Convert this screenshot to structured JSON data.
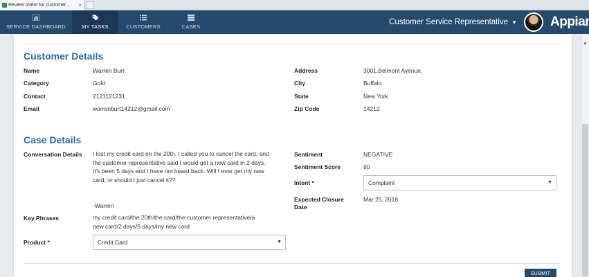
{
  "browser": {
    "tab_title": "Review Intent for customer ...",
    "tab_close": "×"
  },
  "header": {
    "nav": [
      {
        "label": "SERVICE DASHBOARD",
        "icon": "bar-chart-icon"
      },
      {
        "label": "MY TASKS",
        "icon": "tag-icon",
        "active": true
      },
      {
        "label": "CUSTOMERS",
        "icon": "list-icon"
      },
      {
        "label": "CASES",
        "icon": "stack-icon"
      }
    ],
    "role": "Customer Service Representative",
    "brand": "Appian",
    "colors": {
      "bar": "#264a6e",
      "active_tab": "#1c3856"
    }
  },
  "customer_details": {
    "title": "Customer Details",
    "left": [
      {
        "label": "Name",
        "value": "Warren Burt"
      },
      {
        "label": "Category",
        "value": "Gold"
      },
      {
        "label": "Contact",
        "value": "2121121231"
      },
      {
        "label": "Email",
        "value": "warrenburt14212@gmail.com"
      }
    ],
    "right": [
      {
        "label": "Address",
        "value": "3001,Belmont Avenue,"
      },
      {
        "label": "City",
        "value": "Buffalo"
      },
      {
        "label": "State",
        "value": "New York"
      },
      {
        "label": "Zip Code",
        "value": "14212"
      }
    ]
  },
  "case_details": {
    "title": "Case Details",
    "conversation_label": "Conversation Details",
    "conversation_lines": [
      "I lost my credit card on the 20th. I called you to cancel the card, and",
      "the customer representative said I would get a new card in 2 days.",
      "It's been 5 days and I have not heard back. Will I ever get my new",
      "card, or should I just cancel it??"
    ],
    "signature": "-Warren",
    "key_phrases_label": "Key Phrases",
    "key_phrases_lines": [
      "my credit card/the 20th/the card/the customer representative/a",
      "new card/2 days/5 days/my new card"
    ],
    "product_label": "Product *",
    "product_value": "Credit Card",
    "sentiment_label": "Sentiment",
    "sentiment_value": "NEGATIVE",
    "score_label": "Sentiment Score",
    "score_value": "90",
    "intent_label": "Intent *",
    "intent_value": "Complaint",
    "closure_label_lines": [
      "Expected Closure",
      "Date"
    ],
    "closure_value": "Mar 25, 2018"
  },
  "actions": {
    "submit": "SUBMIT"
  },
  "misc": {
    "select_caret": "▼",
    "role_caret": "▼",
    "scroll_up": "▲"
  }
}
